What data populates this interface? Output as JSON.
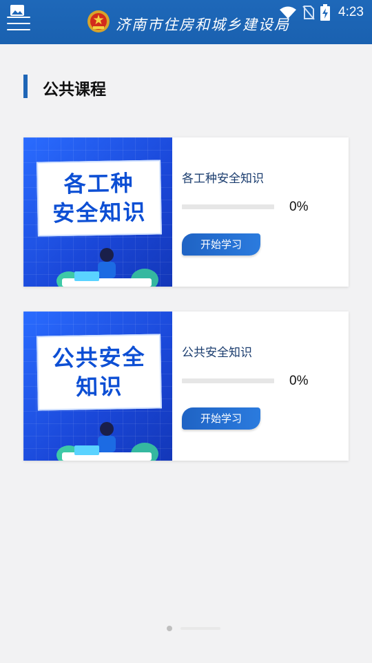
{
  "status_bar": {
    "time": "4:23"
  },
  "header": {
    "title": "济南市住房和城乡建设局"
  },
  "section": {
    "title": "公共课程"
  },
  "courses": [
    {
      "thumb_lines": [
        "各工种",
        "安全知识"
      ],
      "title": "各工种安全知识",
      "progress": 0,
      "progress_text": "0%",
      "button": "开始学习"
    },
    {
      "thumb_lines": [
        "公共安全",
        "知识"
      ],
      "title": "公共安全知识",
      "progress": 0,
      "progress_text": "0%",
      "button": "开始学习"
    }
  ],
  "colors": {
    "header_bg": "#1e68b9",
    "accent": "#1f66b6",
    "page_bg": "#f2f2f3"
  }
}
